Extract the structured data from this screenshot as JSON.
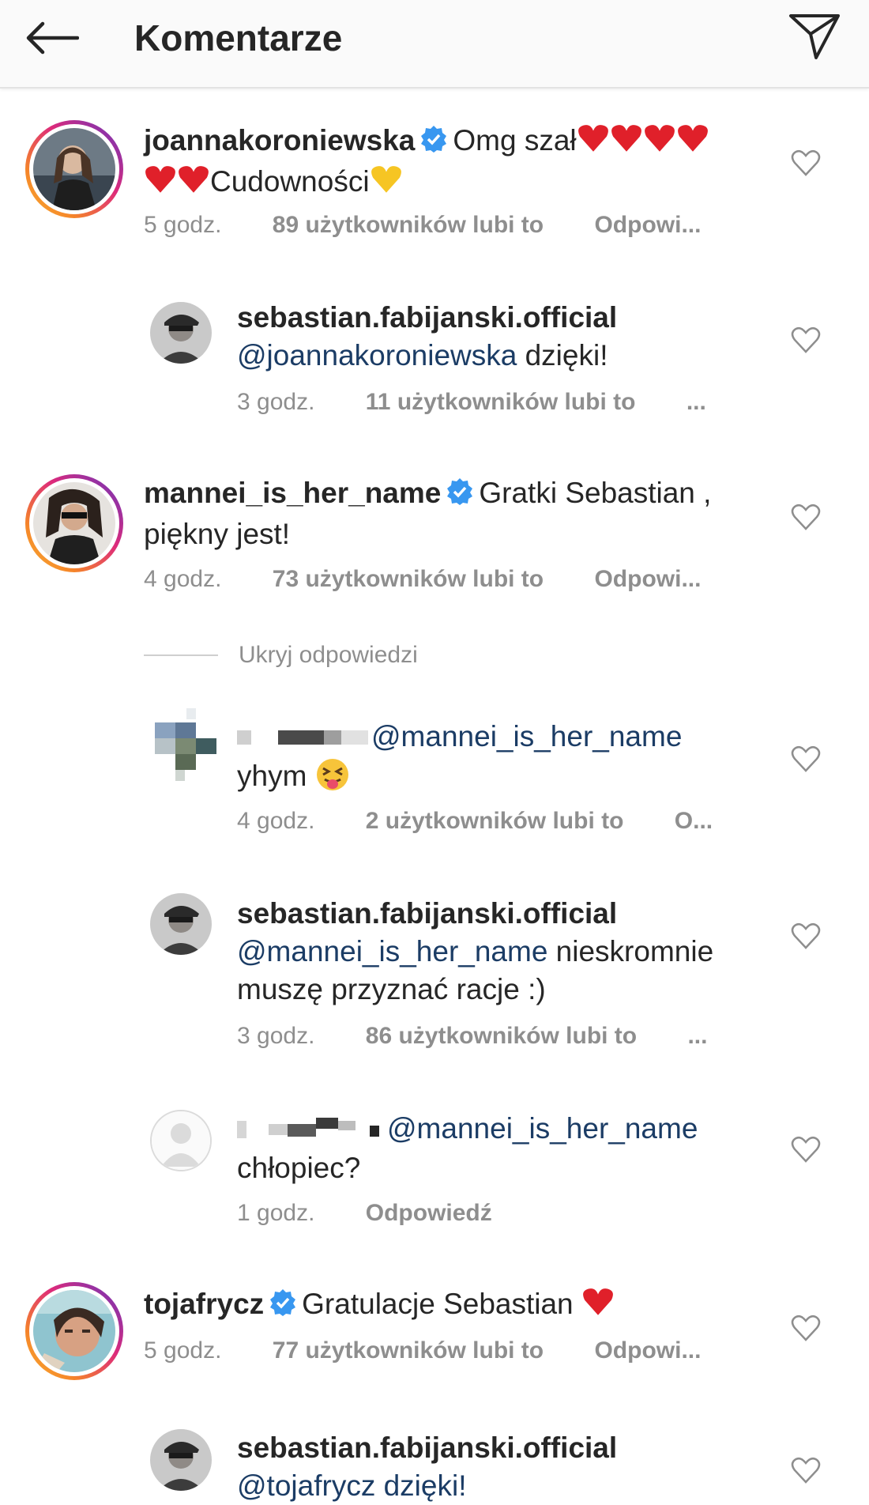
{
  "header": {
    "title": "Komentarze",
    "back_icon": "arrow-left-icon",
    "send_icon": "paper-plane-icon"
  },
  "colors": {
    "mention": "#1b3c65",
    "verified": "#3897f0",
    "meta": "#8e8e8e",
    "heart_red": "#e0202a",
    "heart_yellow": "#f6c523"
  },
  "comments": [
    {
      "username": "joannakoroniewska",
      "text_a": "Omg szał",
      "text_b": "Cudowności",
      "time": "5 godz.",
      "likes": "89 użytkowników lubi to",
      "reply": "Odpowi..."
    },
    {
      "username": "sebastian.fabijanski.official",
      "mention": "@joannakoroniewska",
      "text": " dzięki!",
      "time": "3 godz.",
      "likes": "11 użytkowników lubi to",
      "reply": "..."
    },
    {
      "username": "mannei_is_her_name",
      "text_a": "Gratki Sebastian ,",
      "text_b": "piękny jest!",
      "time": "4 godz.",
      "likes": "73 użytkowników lubi to",
      "reply": "Odpowi..."
    },
    {
      "mention": "@mannei_is_her_name",
      "text": "yhym",
      "time": "4 godz.",
      "likes": "2 użytkowników lubi to",
      "reply": "O..."
    },
    {
      "username": "sebastian.fabijanski.official",
      "mention": "@mannei_is_her_name",
      "text_a": " nieskromnie",
      "text_b": "muszę przyznać racje :)",
      "time": "3 godz.",
      "likes": "86 użytkowników lubi to",
      "reply": "..."
    },
    {
      "mention": "@mannei_is_her_name",
      "text": "chłopiec?",
      "time": "1 godz.",
      "reply": "Odpowiedź"
    },
    {
      "username": "tojafrycz",
      "text": "Gratulacje Sebastian",
      "time": "5 godz.",
      "likes": "77 użytkowników lubi to",
      "reply": "Odpowi..."
    },
    {
      "username": "sebastian.fabijanski.official",
      "partial_mention": "@tojafrycz dzięki!"
    }
  ],
  "hide_replies": "Ukryj odpowiedzi"
}
